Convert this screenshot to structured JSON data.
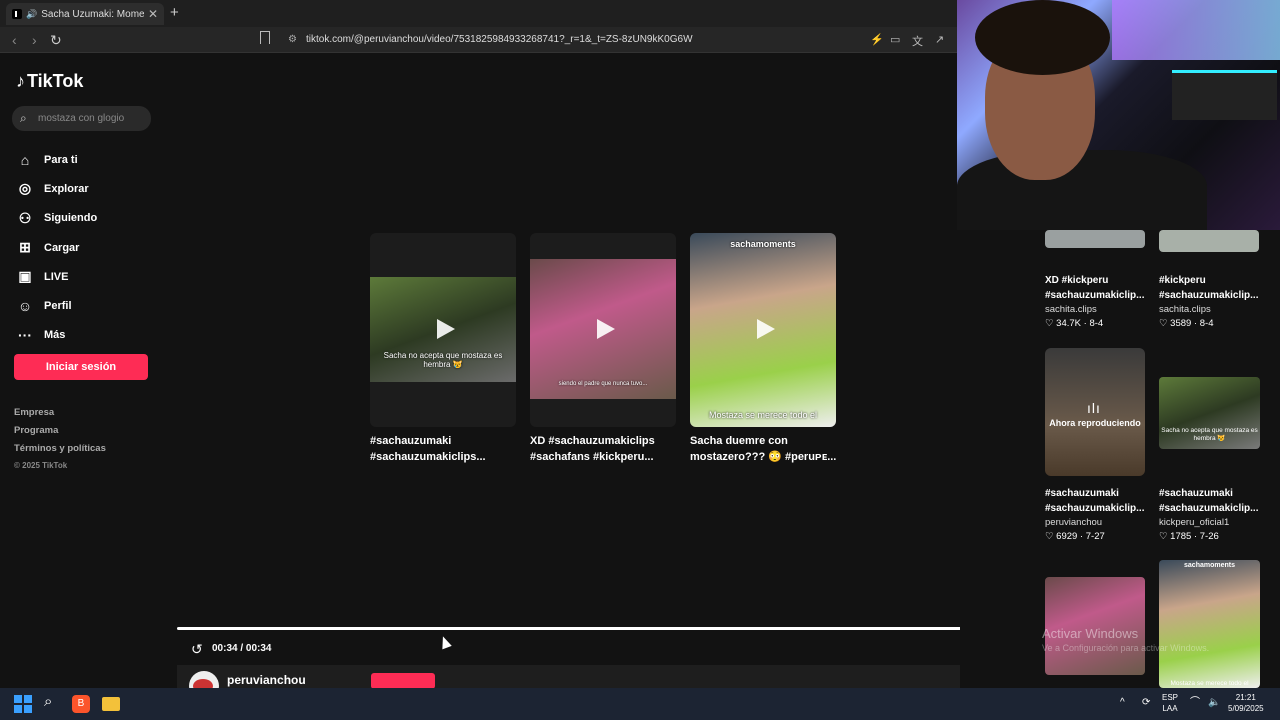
{
  "browser": {
    "tab_title": "Sacha Uzumaki: Momentos D",
    "tab_close": "✕",
    "new_tab": "+",
    "url": "tiktok.com/@peruvianchou/video/7531825984933268741?_r=1&_t=ZS-8zUN9kK0G6W"
  },
  "sidebar": {
    "logo": "TikTok",
    "search_placeholder": "mostaza con glogio",
    "items": [
      {
        "label": "Para ti",
        "icon": "home-icon"
      },
      {
        "label": "Explorar",
        "icon": "compass-icon"
      },
      {
        "label": "Siguiendo",
        "icon": "following-icon"
      },
      {
        "label": "Cargar",
        "icon": "upload-icon"
      },
      {
        "label": "LIVE",
        "icon": "live-icon"
      },
      {
        "label": "Perfil",
        "icon": "profile-icon"
      },
      {
        "label": "Más",
        "icon": "more-icon"
      }
    ],
    "login": "Iniciar sesión",
    "footer": [
      "Empresa",
      "Programa",
      "Términos y políticas"
    ],
    "copyright": "© 2025 TikTok"
  },
  "main": {
    "cards": [
      {
        "title": "#sachauzumaki #sachauzumakiclips...",
        "caption": "Sacha no acepta que mostaza es hembra 😿"
      },
      {
        "title": "XD #sachauzumakiclips #sachafans #kickperu...",
        "caption": "siendo el padre que nunca tuvo..."
      },
      {
        "title": "Sacha duemre con mostazero??? 😳 #peruᴘᴇ...",
        "caption": "Mostaza se merece todo el",
        "top_caption": "sachamoments"
      }
    ],
    "time": "00:34 / 00:34",
    "progress": 1.0,
    "author": "peruvianchou"
  },
  "right_panel": {
    "items": [
      {
        "title": "XD #kickperu #sachauzumakiclip...",
        "user": "sachita.clips",
        "likes": "34.7K",
        "date": "8-4"
      },
      {
        "title": "#kickperu #sachauzumakiclip...",
        "user": "sachita.clips",
        "likes": "3589",
        "date": "8-4"
      },
      {
        "title": "#sachauzumaki #sachauzumakiclip...",
        "user": "peruvianchou",
        "likes": "6929",
        "date": "7-27"
      },
      {
        "title": "#sachauzumaki #sachauzumakiclip...",
        "user": "kickperu_oficial1",
        "likes": "1785",
        "date": "7-26"
      }
    ],
    "now_playing": "Ahora reproduciendo",
    "thumb_caption": "Sacha no acepta que mostaza es hembra 😿",
    "thumb_caption2": "Mostaza se merece todo el",
    "thumb_top": "sachamoments"
  },
  "watermark": {
    "line1": "Activar Windows",
    "line2": "Ve a Configuración para activar Windows."
  },
  "taskbar": {
    "lang1": "ESP",
    "lang2": "LAA",
    "time": "21:21",
    "date": "5/09/2025"
  }
}
